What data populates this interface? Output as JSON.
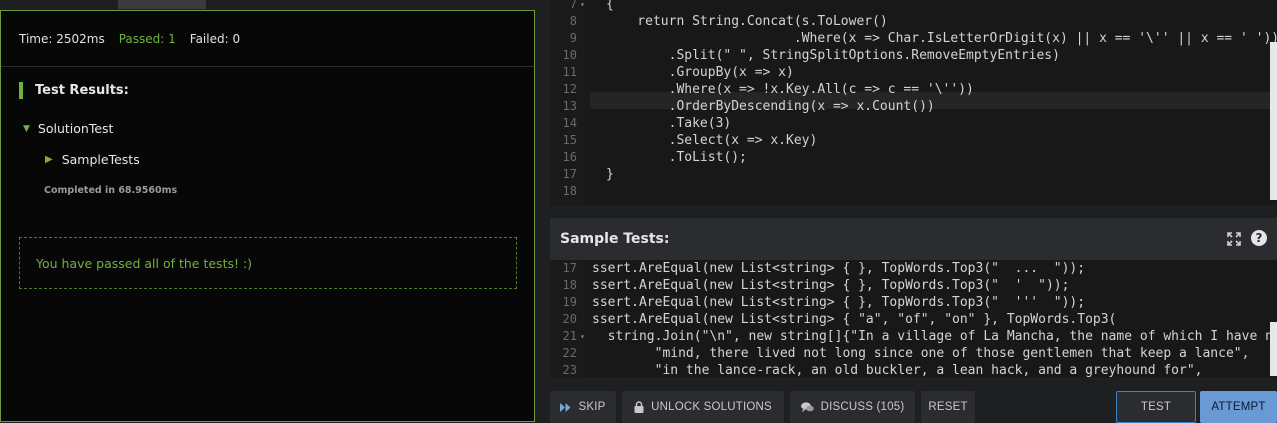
{
  "results": {
    "time": "Time: 2502ms",
    "passed": "Passed: 1",
    "failed": "Failed: 0",
    "title": "Test Results:",
    "suite": "SolutionTest",
    "subtest": "SampleTests",
    "completed": "Completed in 68.9560ms",
    "pass_message": "You have passed all of the tests! :)",
    "accent_color": "#6fb23f"
  },
  "solution_code": {
    "lines": [
      {
        "n": "7",
        "text": "{"
      },
      {
        "n": "8",
        "text": "    return String.Concat(s.ToLower()"
      },
      {
        "n": "9",
        "text": "                        .Where(x => Char.IsLetterOrDigit(x) || x == '\\'' || x == ' '))"
      },
      {
        "n": "10",
        "text": "        .Split(\" \", StringSplitOptions.RemoveEmptyEntries)"
      },
      {
        "n": "11",
        "text": "        .GroupBy(x => x)"
      },
      {
        "n": "12",
        "text": "        .Where(x => !x.Key.All(c => c == '\\''))"
      },
      {
        "n": "13",
        "text": "        .OrderByDescending(x => x.Count())"
      },
      {
        "n": "14",
        "text": "        .Take(3)"
      },
      {
        "n": "15",
        "text": "        .Select(x => x.Key)"
      },
      {
        "n": "16",
        "text": "        .ToList();"
      },
      {
        "n": "17",
        "text": "}"
      },
      {
        "n": "18",
        "text": ""
      }
    ]
  },
  "sample_tests": {
    "title": "Sample Tests:",
    "expand_icon": "expand-icon",
    "help_label": "?",
    "lines": [
      {
        "n": "17",
        "text": "ssert.AreEqual(new List<string> { }, TopWords.Top3(\"  ...  \"));"
      },
      {
        "n": "18",
        "text": "ssert.AreEqual(new List<string> { }, TopWords.Top3(\"  '  \"));"
      },
      {
        "n": "19",
        "text": "ssert.AreEqual(new List<string> { }, TopWords.Top3(\"  '''  \"));"
      },
      {
        "n": "20",
        "text": "ssert.AreEqual(new List<string> { \"a\", \"of\", \"on\" }, TopWords.Top3("
      },
      {
        "n": "21",
        "text": "  string.Join(\"\\n\", new string[]{\"In a village of La Mancha, the name of which I have n"
      },
      {
        "n": "22",
        "text": "        \"mind, there lived not long since one of those gentlemen that keep a lance\","
      },
      {
        "n": "23",
        "text": "        \"in the lance-rack, an old buckler, a lean hack, and a greyhound for\","
      }
    ]
  },
  "toolbar": {
    "skip": "SKIP",
    "unlock": "UNLOCK SOLUTIONS",
    "discuss": "DISCUSS (105)",
    "reset": "RESET",
    "test": "TEST",
    "attempt": "ATTEMPT"
  }
}
